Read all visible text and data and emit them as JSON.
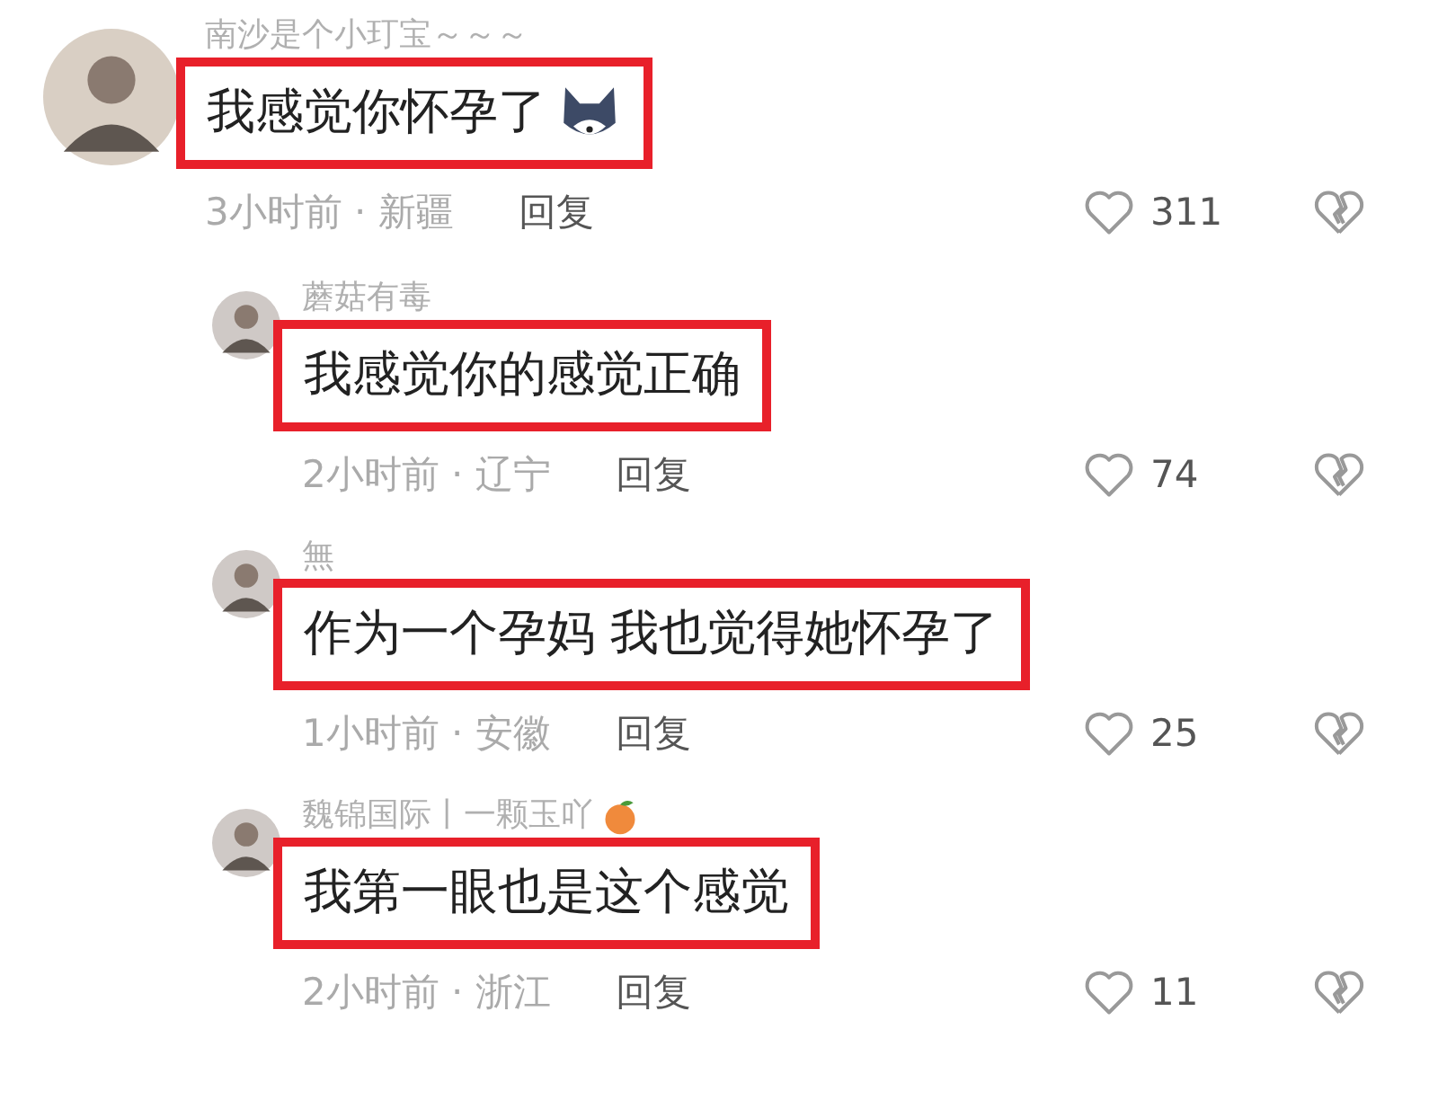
{
  "comments": [
    {
      "kind": "comment",
      "name": "南沙是个小玎宝～～～",
      "name_sticker": false,
      "text": "我感觉你怀孕了",
      "text_sticker": true,
      "highlighted": true,
      "meta": "3小时前 · 新疆",
      "reply": "回复",
      "likes": "311"
    },
    {
      "kind": "reply",
      "name": "蘑菇有毒",
      "name_sticker": false,
      "text": "我感觉你的感觉正确",
      "text_sticker": false,
      "highlighted": true,
      "meta": "2小时前 · 辽宁",
      "reply": "回复",
      "likes": "74"
    },
    {
      "kind": "reply",
      "name": "無",
      "name_sticker": false,
      "text": "作为一个孕妈 我也觉得她怀孕了",
      "text_sticker": false,
      "highlighted": true,
      "meta": "1小时前 · 安徽",
      "reply": "回复",
      "likes": "25"
    },
    {
      "kind": "reply",
      "name": "魏锦国际丨一颗玉吖",
      "name_sticker": true,
      "text": "我第一眼也是这个感觉",
      "text_sticker": false,
      "highlighted": true,
      "meta": "2小时前 · 浙江",
      "reply": "回复",
      "likes": "11"
    }
  ]
}
